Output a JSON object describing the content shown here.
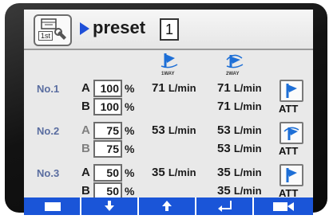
{
  "header": {
    "menu_icon_text": "1st",
    "title": "preset",
    "preset_number": "1"
  },
  "columns": {
    "way1_label": "1WAY",
    "way2_label": "2WAY"
  },
  "rows": [
    {
      "number": "No.1",
      "a_label": "A",
      "a_value": "100",
      "b_label": "B",
      "b_value": "100",
      "percent": "%",
      "way1_flow": "71",
      "way2_flow_a": "71",
      "way2_flow_b": "71",
      "unit": "L/min",
      "att_label": "ATT",
      "att_icon": "1way-valve-icon"
    },
    {
      "number": "No.2",
      "a_label": "A",
      "a_value": "75",
      "b_label": "B",
      "b_value": "75",
      "percent": "%",
      "way1_flow": "53",
      "way2_flow_a": "53",
      "way2_flow_b": "53",
      "unit": "L/min",
      "att_label": "ATT",
      "att_icon": "2way-valve-icon"
    },
    {
      "number": "No.3",
      "a_label": "A",
      "a_value": "50",
      "b_label": "B",
      "b_value": "50",
      "percent": "%",
      "way1_flow": "35",
      "way2_flow_a": "35",
      "way2_flow_b": "35",
      "unit": "L/min",
      "att_label": "ATT",
      "att_icon": "1way-valve-icon"
    }
  ],
  "softkeys": [
    {
      "icon": "return-icon"
    },
    {
      "icon": "arrow-down-icon"
    },
    {
      "icon": "arrow-up-icon"
    },
    {
      "icon": "enter-icon"
    },
    {
      "icon": "camera-icon"
    }
  ],
  "colors": {
    "accent_blue": "#1a55d8",
    "screen_bg": "#e9e9e9",
    "bezel": "#121212"
  }
}
